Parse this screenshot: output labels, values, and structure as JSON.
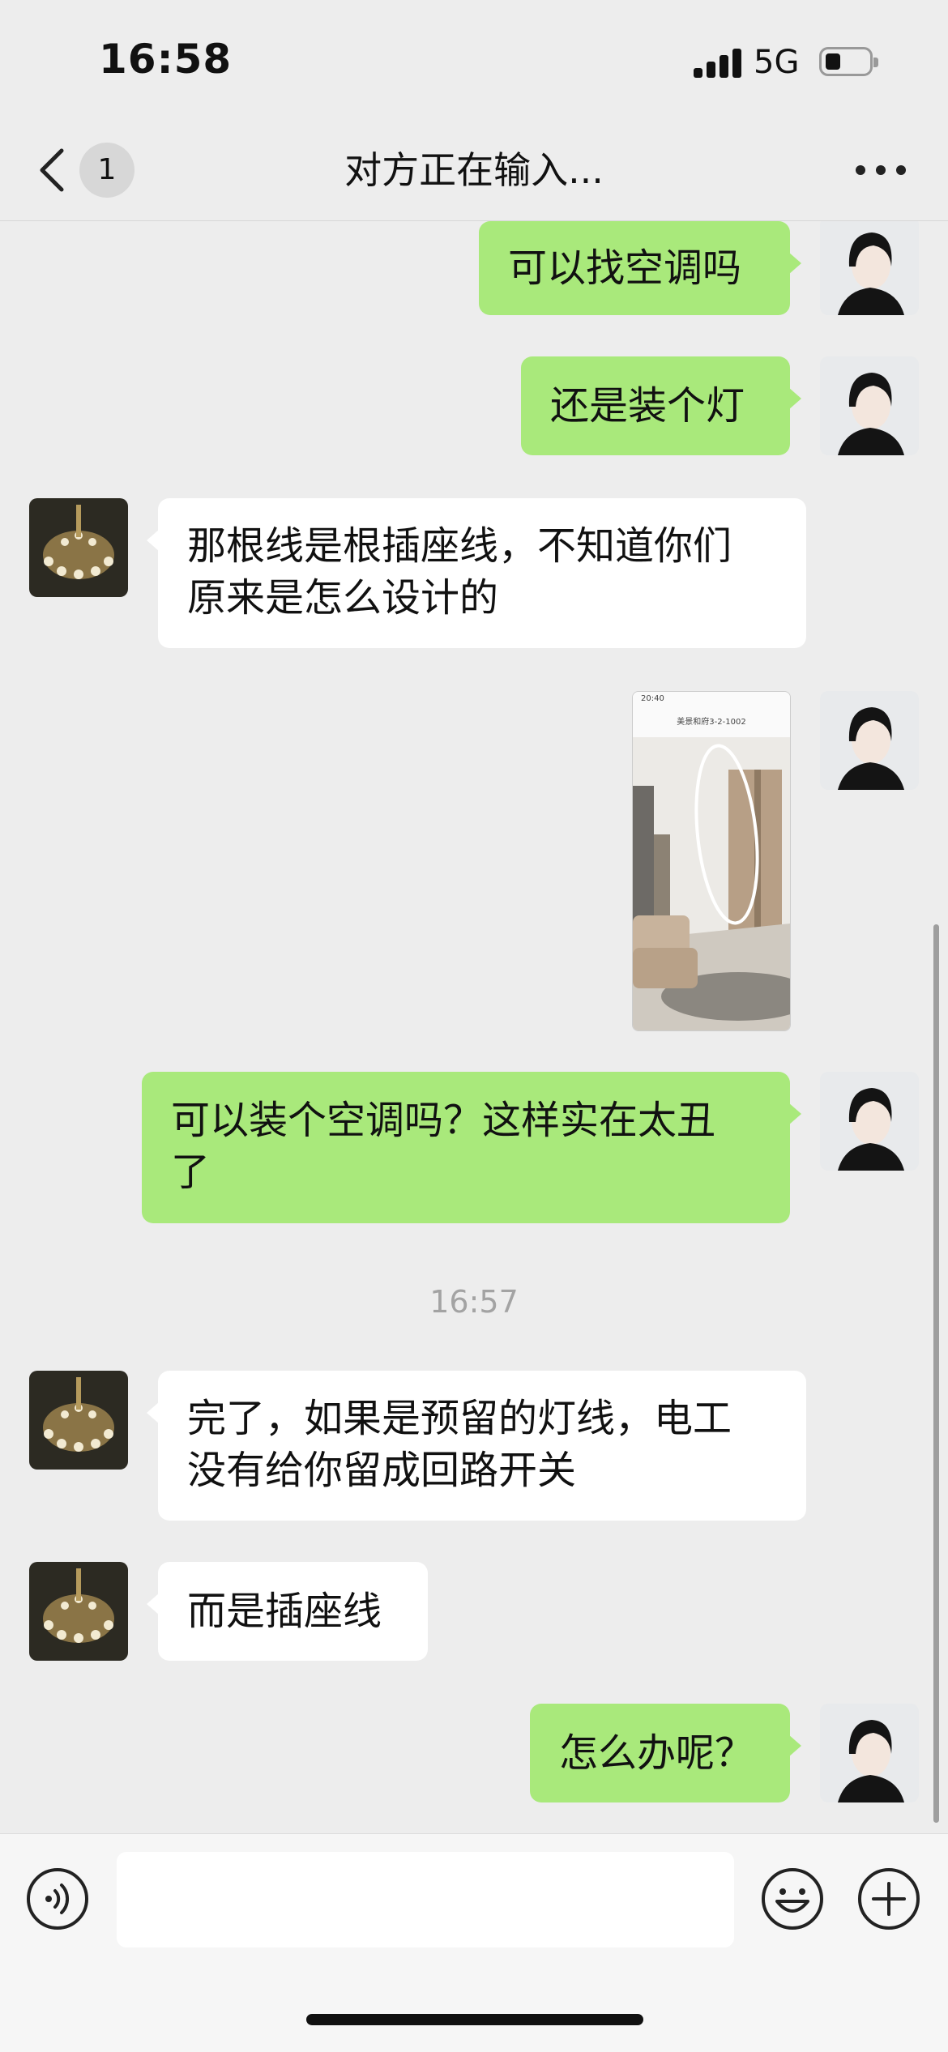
{
  "status": {
    "time": "16:58",
    "network": "5G"
  },
  "nav": {
    "unread_count": "1",
    "title": "对方正在输入..."
  },
  "messages": [
    {
      "side": "me",
      "text": "可以找空调吗"
    },
    {
      "side": "me",
      "text": "还是装个灯"
    },
    {
      "side": "them",
      "line1": "那根线是根插座线，不知道你们",
      "line2": "原来是怎么设计的"
    },
    {
      "side": "me",
      "type": "image",
      "screenshot_header_time": "20:40",
      "screenshot_title": "美景和府3-2-1002"
    },
    {
      "side": "me",
      "line1": "可以装个空调吗？这样实在太丑",
      "line2": "了"
    },
    {
      "side": "them",
      "line1": "完了，如果是预留的灯线，电工",
      "line2": "没有给你留成回路开关"
    },
    {
      "side": "them",
      "text": "而是插座线"
    },
    {
      "side": "me",
      "text": "怎么办呢？"
    }
  ],
  "timestamp": "16:57",
  "input": {
    "value": ""
  },
  "colors": {
    "my_bubble": "#a9e97b",
    "their_bubble": "#ffffff",
    "background": "#ededed"
  }
}
